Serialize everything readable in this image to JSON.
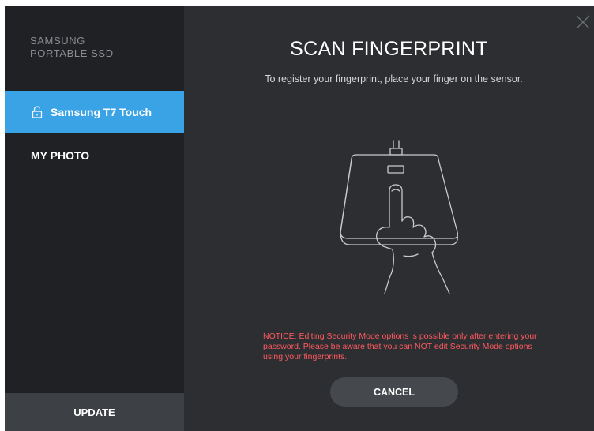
{
  "sidebar": {
    "brand_line1": "SAMSUNG",
    "brand_line2": "PORTABLE SSD",
    "device_label": "Samsung T7 Touch",
    "photo_label": "MY PHOTO",
    "update_label": "UPDATE"
  },
  "main": {
    "title": "SCAN FINGERPRINT",
    "subtitle": "To register your fingerprint, place your finger on the sensor.",
    "notice": "NOTICE: Editing Security Mode options is possible only after entering your password. Please be aware that you can NOT edit Security Mode options using your fingerprints.",
    "cancel_label": "CANCEL"
  },
  "icons": {
    "close": "close-icon",
    "lock": "unlock-icon",
    "illustration": "fingerprint-scan-illustration"
  },
  "colors": {
    "accent": "#3aa3e6",
    "notice": "#ff5a5f",
    "sidebar_bg": "#1f2124",
    "main_bg": "#2c2e31"
  }
}
